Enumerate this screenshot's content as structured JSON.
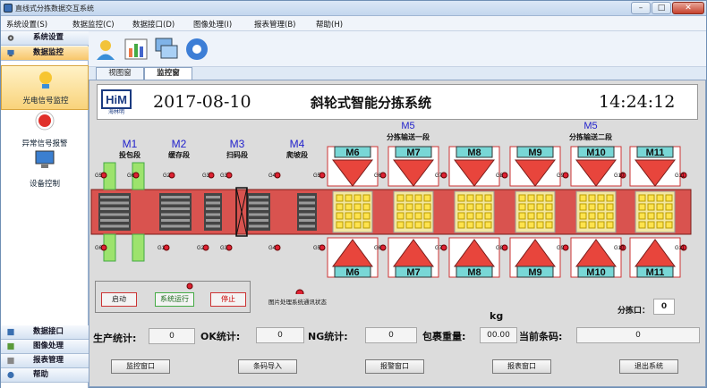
{
  "window": {
    "title": "直线式分拣数据交互系统",
    "min": "–",
    "max": "□",
    "close": "✕"
  },
  "menu": [
    "系统设置(S)",
    "数据监控(C)",
    "数据接口(D)",
    "图像处理(I)",
    "报表管理(B)",
    "帮助(H)"
  ],
  "sidebar": {
    "top": [
      {
        "label": "系统设置",
        "icon": "gear-icon"
      },
      {
        "label": "数据监控",
        "icon": "monitor-icon",
        "active": true
      }
    ],
    "items": [
      {
        "label": "光电信号监控",
        "icon": "lamp-icon",
        "selected": true
      },
      {
        "label": "异常信号报警",
        "icon": "alarm-icon"
      },
      {
        "label": "设备控制",
        "icon": "computer-icon"
      }
    ],
    "bottom": [
      {
        "label": "数据接口",
        "icon": "database-icon"
      },
      {
        "label": "图像处理",
        "icon": "image-icon"
      },
      {
        "label": "报表管理",
        "icon": "report-icon"
      },
      {
        "label": "帮助",
        "icon": "help-icon"
      }
    ]
  },
  "toolbar": [
    {
      "icon": "user-icon"
    },
    {
      "icon": "chart-icon"
    },
    {
      "icon": "windows-icon"
    },
    {
      "icon": "settings-icon"
    }
  ],
  "tabs": [
    {
      "label": "视图窗",
      "active": false
    },
    {
      "label": "监控窗",
      "active": true
    }
  ],
  "header": {
    "logo": "HiM",
    "logo_sub": "海林明",
    "date": "2017-08-10",
    "title": "斜轮式智能分拣系统",
    "time": "14:24:12"
  },
  "zones": [
    {
      "code": "M1",
      "name": "投包段"
    },
    {
      "code": "M2",
      "name": "缓存段"
    },
    {
      "code": "M3",
      "name": "扫码段"
    },
    {
      "code": "M4",
      "name": "爬坡段"
    }
  ],
  "sorting_groups": [
    {
      "code": "M5",
      "name": "分拣输送一段"
    },
    {
      "code": "M5",
      "name": "分拣输送二段"
    }
  ],
  "sort_modules": [
    "M6",
    "M7",
    "M8",
    "M9",
    "M10",
    "M11"
  ],
  "sensors_top": [
    "G5",
    "G6",
    "G2",
    "G3",
    "G3",
    "G4",
    "G5",
    "G6",
    "G7",
    "G8",
    "G9",
    "G10",
    "G11"
  ],
  "sensors_bottom": [
    "G6",
    "G1",
    "G2",
    "G3",
    "G4",
    "G5",
    "G6",
    "G7",
    "G8",
    "G9",
    "G10",
    "G11"
  ],
  "controls": {
    "start": "启动",
    "running": "系统运行",
    "stop": "停止",
    "image_status": "图片处理系统通讯状态"
  },
  "outlet": {
    "label": "分拣口：",
    "value": "0"
  },
  "stats": {
    "production_label": "生产统计:",
    "production": "0",
    "ok_label": "OK统计:",
    "ok": "0",
    "ng_label": "NG统计:",
    "ng": "0",
    "weight_label": "包裹重量:",
    "weight": "00.00",
    "weight_unit": "kg",
    "barcode_label": "当前条码:",
    "barcode": "0"
  },
  "buttons": [
    "监控窗口",
    "条码导入",
    "报警窗口",
    "报表窗口",
    "退出系统"
  ],
  "colors": {
    "belt": "#d9534f",
    "belt_dark": "#7a1c1a",
    "module_red": "#e8453c",
    "label_cyan": "#78d7d6",
    "yellow": "#ffe34d",
    "green": "#9de36d",
    "title_blue": "#2222cc"
  }
}
